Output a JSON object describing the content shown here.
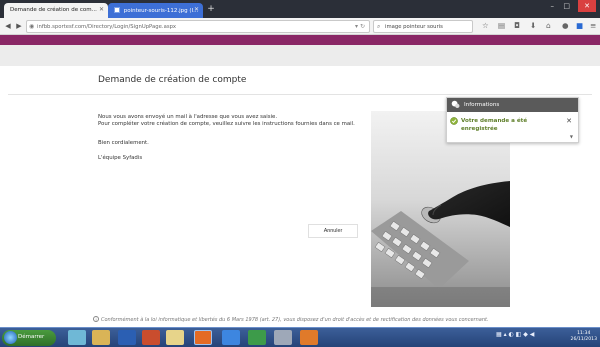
{
  "browser": {
    "tabs": [
      {
        "label": "Demande de création de com...",
        "active": true
      },
      {
        "label": "pointeur-souris-112.jpg (I...",
        "active": false
      }
    ],
    "url": "infbb.sportesf.com/Directory/Login/SignUpPage.aspx",
    "search_value": "image pointeur souris"
  },
  "page": {
    "title": "Demande de création de compte",
    "paragraph1_line1": "Nous vous avons envoyé un mail à l'adresse que vous avez saisie.",
    "paragraph1_line2": "Pour compléter votre création de compte, veuillez suivre les instructions fournies dans ce mail.",
    "greeting": "Bien cordialement.",
    "signature": "L'équipe Syfadis",
    "cancel_label": "Annuler",
    "legal_text": "Conformément à la loi informatique et libertés du 6 Mars 1978 (art. 27), vous disposez d'un droit d'accès et de rectification des données vous concernant."
  },
  "notification": {
    "header": "Informations",
    "message_line1": "Votre demande a été",
    "message_line2": "enregistrée",
    "close_glyph": "✕"
  },
  "taskbar": {
    "start_label": "Démarrer",
    "time": "11:34",
    "date": "26/11/2013"
  },
  "colors": {
    "brand_band": "#8a2766",
    "notification_header": "#5a5a5a",
    "success_green": "#5f7f2a",
    "active_tab": "#3d6fd6"
  }
}
